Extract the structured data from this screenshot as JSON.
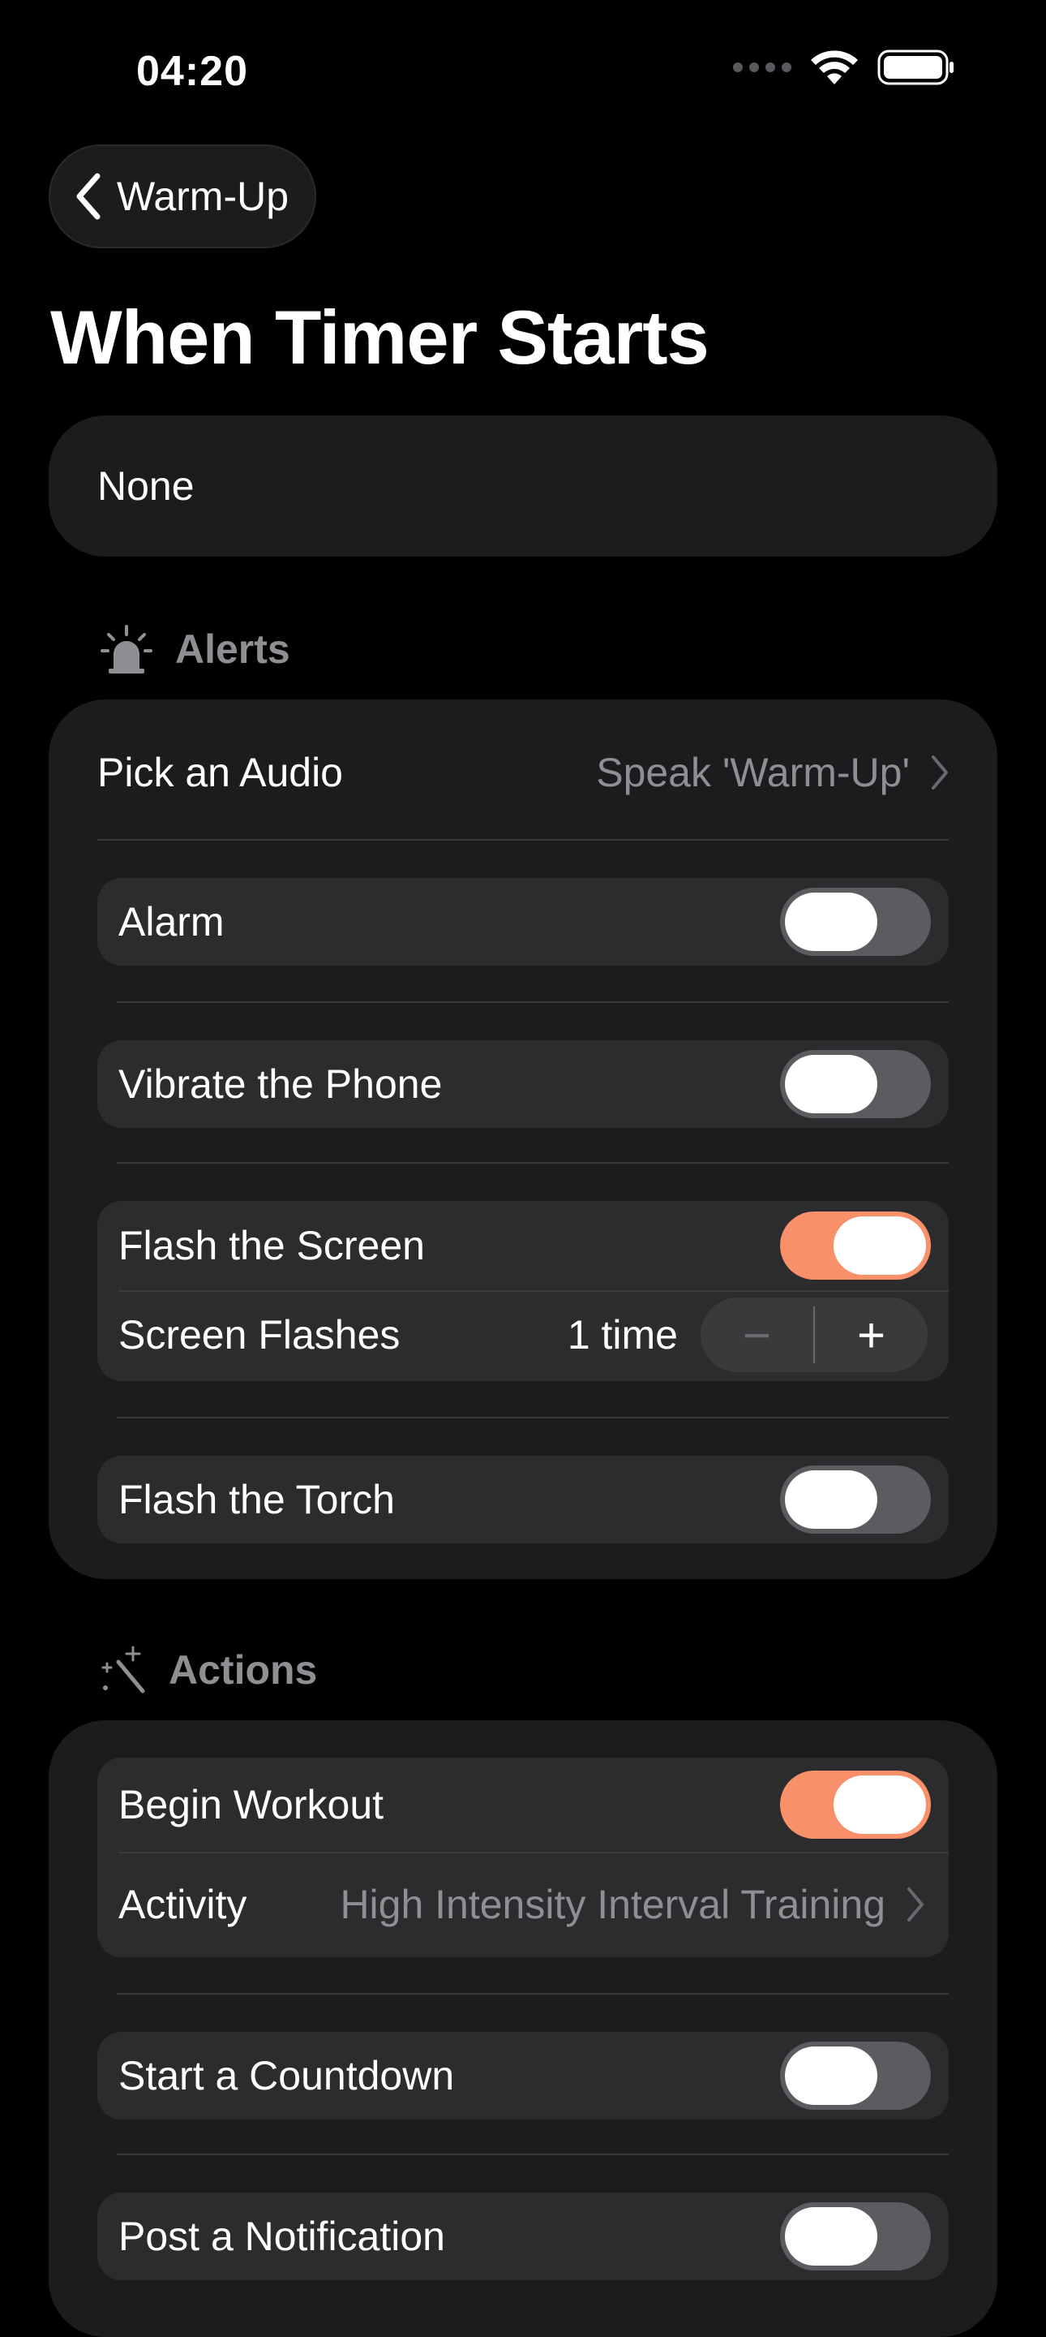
{
  "status": {
    "time": "04:20"
  },
  "nav": {
    "back_label": "Warm-Up"
  },
  "page": {
    "title": "When Timer Starts"
  },
  "preset": {
    "value": "None"
  },
  "alerts": {
    "header": "Alerts",
    "pick_audio_label": "Pick an Audio",
    "pick_audio_value": "Speak 'Warm-Up'",
    "alarm_label": "Alarm",
    "alarm_on": false,
    "vibrate_label": "Vibrate the Phone",
    "vibrate_on": false,
    "flash_screen_label": "Flash the Screen",
    "flash_screen_on": true,
    "screen_flashes_label": "Screen Flashes",
    "screen_flashes_value": "1 time",
    "stepper_minus": "−",
    "stepper_plus": "+",
    "flash_torch_label": "Flash the Torch",
    "flash_torch_on": false
  },
  "actions": {
    "header": "Actions",
    "begin_workout_label": "Begin Workout",
    "begin_workout_on": true,
    "activity_label": "Activity",
    "activity_value": "High Intensity Interval Training",
    "countdown_label": "Start a Countdown",
    "countdown_on": false,
    "notification_label": "Post a Notification",
    "notification_on": false
  },
  "colors": {
    "accent": "#f8906a",
    "card": "#1c1c1e",
    "inner": "#2c2c2e",
    "secondary_text": "#8e8e93"
  }
}
